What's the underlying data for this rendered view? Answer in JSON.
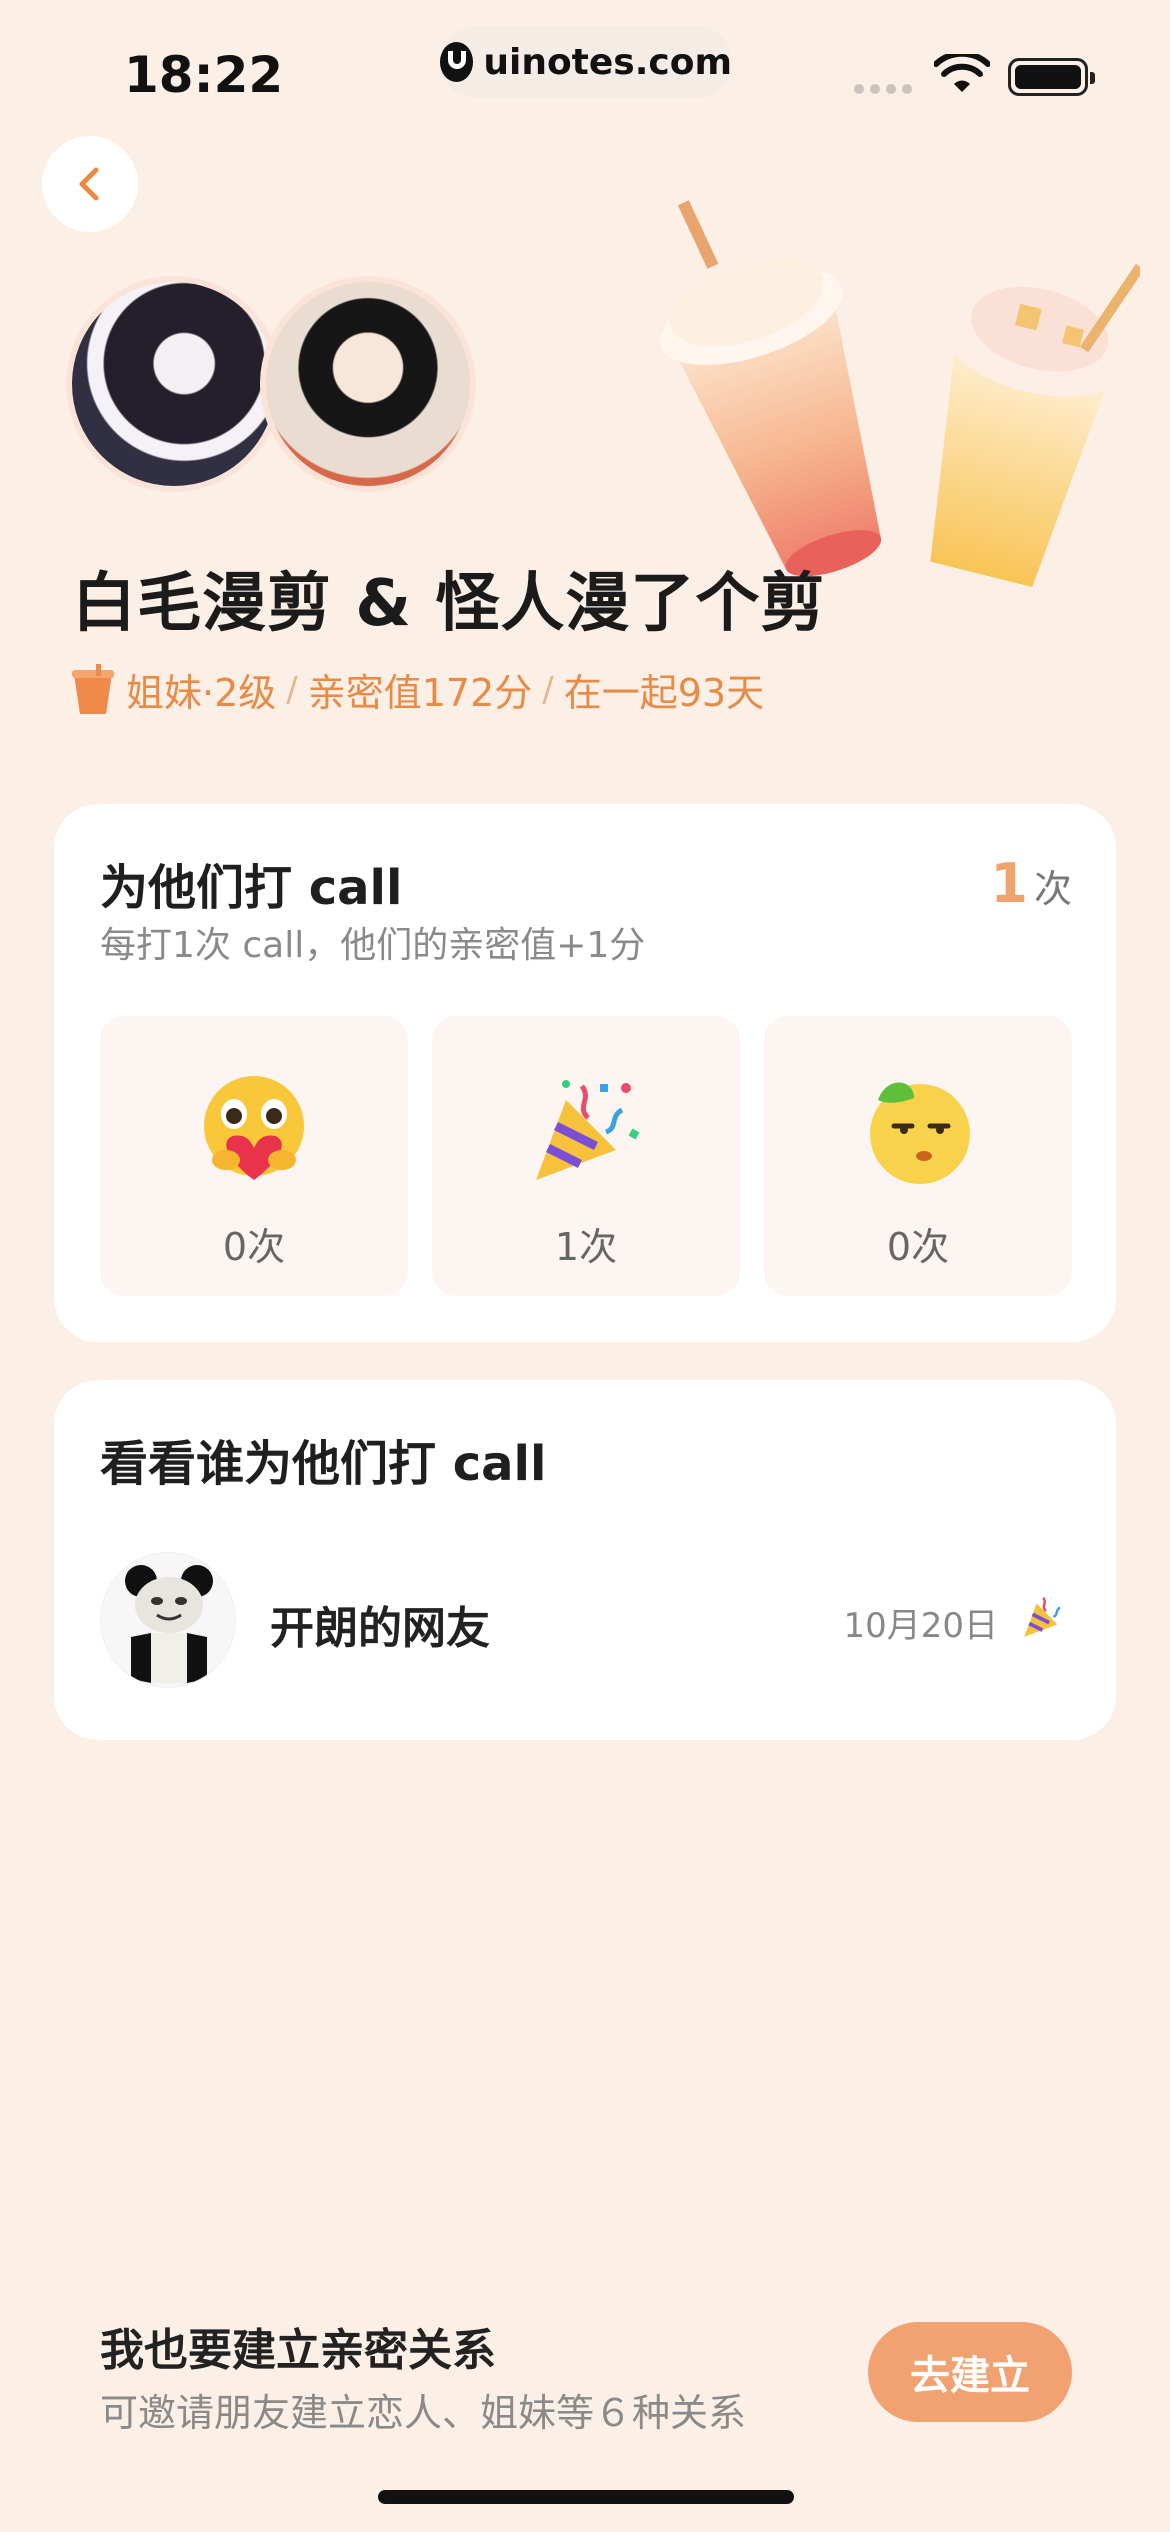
{
  "status_bar": {
    "time": "18:22",
    "url": "uinotes.com"
  },
  "header": {
    "title": "白毛漫剪 & 怪人漫了个剪",
    "relation": "姐妹·2级",
    "intimacy": "亲密值172分",
    "days_together": "在一起93天",
    "separator": "/"
  },
  "call_card": {
    "title": "为他们打 call",
    "subtitle": "每打1次 call，他们的亲密值+1分",
    "count_number": "1",
    "count_unit": "次",
    "tiles": [
      {
        "icon": "hug-face-icon",
        "count": "0次"
      },
      {
        "icon": "party-popper-icon",
        "count": "1次"
      },
      {
        "icon": "lemon-face-icon",
        "count": "0次"
      }
    ]
  },
  "supporters_card": {
    "title": "看看谁为他们打 call",
    "items": [
      {
        "name": "开朗的网友",
        "date": "10月20日",
        "icon": "party-popper-icon"
      }
    ]
  },
  "footer": {
    "title": "我也要建立亲密关系",
    "subtitle": "可邀请朋友建立恋人、姐妹等６种关系",
    "button_label": "去建立"
  },
  "colors": {
    "background": "#fcefe6",
    "accent": "#e98a45",
    "button": "#f2a270"
  }
}
